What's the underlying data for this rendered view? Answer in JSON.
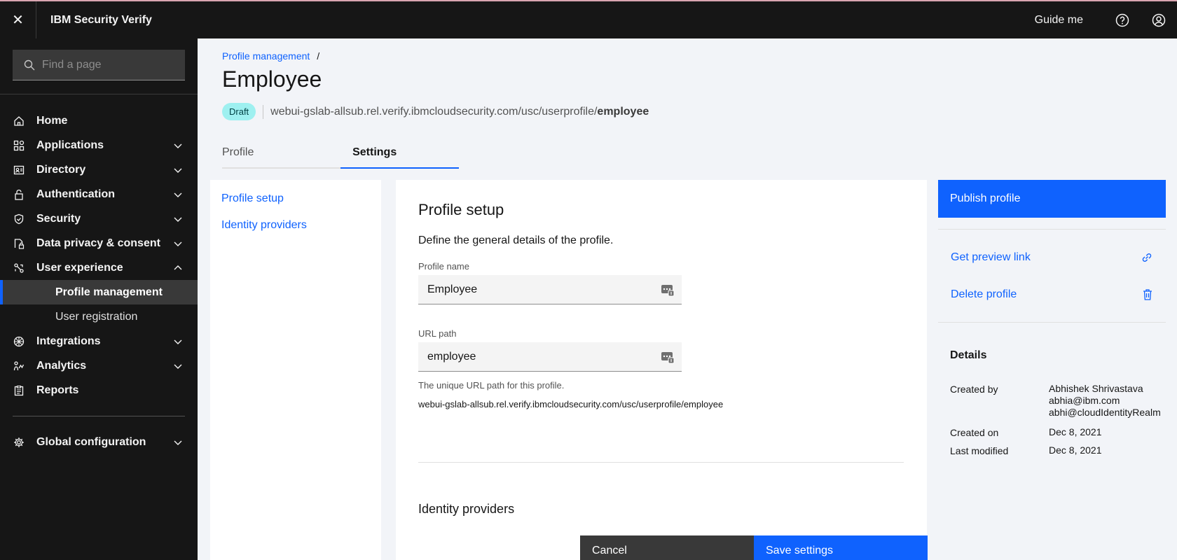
{
  "header": {
    "brand": "IBM Security Verify",
    "guide_label": "Guide me"
  },
  "sidebar": {
    "search_placeholder": "Find a page",
    "items": [
      {
        "label": "Home",
        "icon": "home-icon"
      },
      {
        "label": "Applications",
        "icon": "applications-icon"
      },
      {
        "label": "Directory",
        "icon": "directory-icon"
      },
      {
        "label": "Authentication",
        "icon": "lock-icon"
      },
      {
        "label": "Security",
        "icon": "shield-icon"
      },
      {
        "label": "Data privacy & consent",
        "icon": "data-privacy-icon"
      },
      {
        "label": "User experience",
        "icon": "user-experience-icon"
      },
      {
        "label": "Integrations",
        "icon": "integrations-icon"
      },
      {
        "label": "Analytics",
        "icon": "analytics-icon"
      },
      {
        "label": "Reports",
        "icon": "reports-icon"
      },
      {
        "label": "Global configuration",
        "icon": "gear-icon"
      }
    ],
    "sub_items": [
      "Profile management",
      "User registration"
    ]
  },
  "main": {
    "breadcrumb": "Profile management",
    "breadcrumb_sep": "/",
    "title": "Employee",
    "badge": "Draft",
    "url_prefix": "webui-gslab-allsub.rel.verify.ibmcloudsecurity.com/usc/userprofile/",
    "url_slug": "employee",
    "tabs": [
      "Profile",
      "Settings"
    ],
    "active_tab": "Settings"
  },
  "leftnav": {
    "links": [
      "Profile setup",
      "Identity providers"
    ]
  },
  "card": {
    "heading": "Profile setup",
    "description": "Define the general details of the profile.",
    "profile_name_label": "Profile name",
    "profile_name_value": "Employee",
    "url_path_label": "URL path",
    "url_path_value": "employee",
    "helper": "The unique URL path for this profile.",
    "full_url": "webui-gslab-allsub.rel.verify.ibmcloudsecurity.com/usc/userprofile/employee",
    "section2": "Identity providers"
  },
  "footer": {
    "cancel": "Cancel",
    "save": "Save settings"
  },
  "right": {
    "publish": "Publish profile",
    "preview": "Get preview link",
    "delete": "Delete profile",
    "details_heading": "Details",
    "created_by_label": "Created by",
    "created_by_name": "Abhishek Shrivastava",
    "created_by_email": "abhia@ibm.com",
    "created_by_realm": "abhi@cloudIdentityRealm",
    "created_on_label": "Created on",
    "created_on": "Dec 8, 2021",
    "modified_label": "Last modified",
    "modified_on": "Dec 8, 2021"
  },
  "colors": {
    "accent": "#0f62fe",
    "shell": "#161616",
    "badge": "#9ef0f0"
  }
}
